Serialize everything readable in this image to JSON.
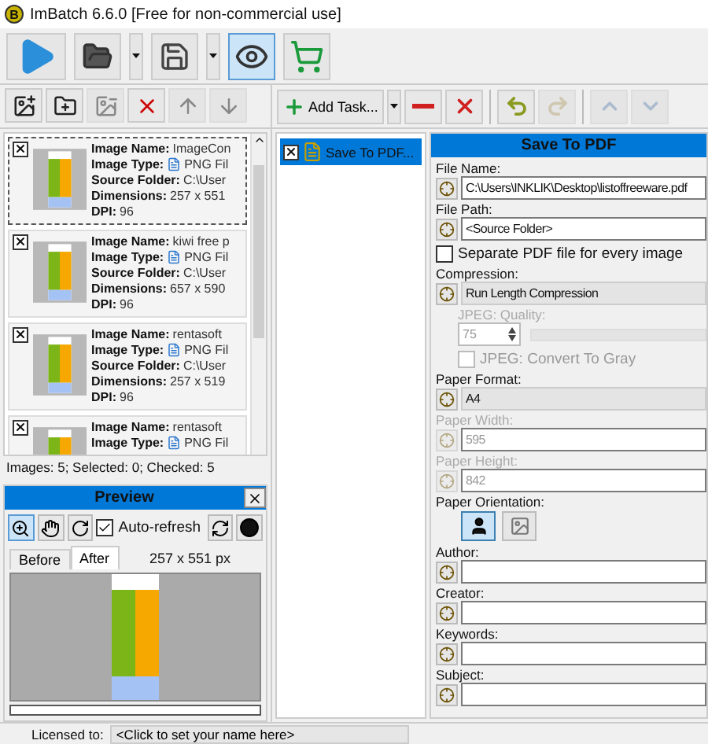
{
  "window": {
    "logo_letter": "B",
    "title": "ImBatch 6.6.0 [Free for non-commercial use]"
  },
  "main_toolbar": {
    "preview_on": true
  },
  "image_toolbar": [
    {
      "kind": "add-image",
      "disabled": false
    },
    {
      "kind": "add-folder",
      "disabled": false
    },
    {
      "kind": "remove",
      "disabled": true
    },
    {
      "kind": "remove-all",
      "disabled": false
    },
    {
      "kind": "up",
      "disabled": true
    },
    {
      "kind": "down",
      "disabled": true
    }
  ],
  "images": [
    {
      "checked": true,
      "focused": true,
      "fields": [
        {
          "label": "Image Name:",
          "value": "ImageCon"
        },
        {
          "label": "Image Type:",
          "value": "PNG Fil",
          "icon": true
        },
        {
          "label": "Source Folder:",
          "value": "C:\\User"
        },
        {
          "label": "Dimensions:",
          "value": "257 x 551"
        },
        {
          "label": "DPI:",
          "value": "96"
        }
      ]
    },
    {
      "checked": true,
      "focused": false,
      "fields": [
        {
          "label": "Image Name:",
          "value": "kiwi free p"
        },
        {
          "label": "Image Type:",
          "value": "PNG Fil",
          "icon": true
        },
        {
          "label": "Source Folder:",
          "value": "C:\\User"
        },
        {
          "label": "Dimensions:",
          "value": "657 x 590"
        },
        {
          "label": "DPI:",
          "value": "96"
        }
      ]
    },
    {
      "checked": true,
      "focused": false,
      "fields": [
        {
          "label": "Image Name:",
          "value": "rentasoft"
        },
        {
          "label": "Image Type:",
          "value": "PNG Fil",
          "icon": true
        },
        {
          "label": "Source Folder:",
          "value": "C:\\User"
        },
        {
          "label": "Dimensions:",
          "value": "257 x 519"
        },
        {
          "label": "DPI:",
          "value": "96"
        }
      ]
    },
    {
      "checked": true,
      "focused": false,
      "fields": [
        {
          "label": "Image Name:",
          "value": "rentasoft"
        },
        {
          "label": "Image Type:",
          "value": "PNG Fil",
          "icon": true
        }
      ]
    }
  ],
  "images_status": "Images: 5; Selected: 0; Checked: 5",
  "preview": {
    "title": "Preview",
    "auto_refresh": {
      "label": "Auto-refresh",
      "checked": true
    },
    "tabs": [
      {
        "label": "Before",
        "selected": false
      },
      {
        "label": "After",
        "selected": true
      }
    ],
    "size": "257 x 551 px",
    "progress": {
      "level": 0
    }
  },
  "task_toolbar": {
    "add_label": "Add Task...",
    "buttons": [
      {
        "kind": "remove",
        "disabled": false
      },
      {
        "kind": "clear",
        "disabled": false
      },
      {
        "kind": "undo",
        "disabled": false
      },
      {
        "kind": "redo",
        "disabled": true
      },
      {
        "kind": "up",
        "disabled": true
      },
      {
        "kind": "down",
        "disabled": true
      }
    ]
  },
  "tasks": [
    {
      "label": "Save To PDF...",
      "checked": true,
      "selected": true
    }
  ],
  "settings": {
    "title": "Save To PDF",
    "rows": [
      {
        "kind": "text",
        "label": "File Name:",
        "value": "C:\\Users\\INKLIK\\Desktop\\listoffreeware.pdf",
        "disabled": false
      },
      {
        "kind": "text",
        "label": "File Path:",
        "value": "<Source Folder>",
        "disabled": false
      },
      {
        "kind": "checkbox",
        "label": "Separate PDF file for every image",
        "checked": false,
        "disabled": false
      },
      {
        "kind": "select",
        "label": "Compression:",
        "value": "Run Length Compression",
        "disabled": false
      },
      {
        "kind": "spin",
        "label": "JPEG: Quality:",
        "value": "75",
        "disabled": true
      },
      {
        "kind": "checkbox",
        "label": "JPEG: Convert To Gray",
        "checked": false,
        "disabled": true
      },
      {
        "kind": "select",
        "label": "Paper Format:",
        "value": "A4",
        "disabled": false
      },
      {
        "kind": "text",
        "label": "Paper Width:",
        "value": "595",
        "disabled": true
      },
      {
        "kind": "text",
        "label": "Paper Height:",
        "value": "842",
        "disabled": true
      },
      {
        "kind": "orientation",
        "label": "Paper Orientation:",
        "options": [
          {
            "kind": "portrait",
            "selected": true
          },
          {
            "kind": "landscape",
            "selected": false
          }
        ]
      },
      {
        "kind": "text",
        "label": "Author:",
        "disabled": false
      },
      {
        "kind": "text",
        "label": "Creator:",
        "disabled": false
      },
      {
        "kind": "text",
        "label": "Keywords:",
        "disabled": false
      },
      {
        "kind": "text",
        "label": "Subject:",
        "disabled": false
      }
    ]
  },
  "status_bar": {
    "label": "Licensed to:",
    "value": "<Click to set your name here>"
  }
}
